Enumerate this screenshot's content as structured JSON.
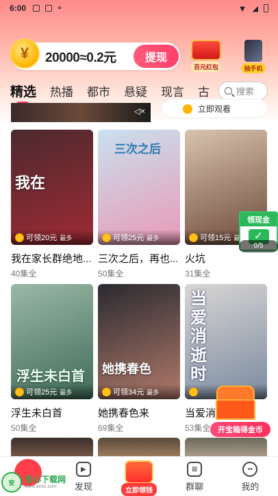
{
  "status_bar": {
    "time": "6:00"
  },
  "header": {
    "coin_text": "20000≈0.2元",
    "coin_symbol": "¥",
    "withdraw_label": "提现",
    "promo1_label": "百元红包",
    "promo2_label": "抽手机"
  },
  "tabs": [
    "精选",
    "热播",
    "都市",
    "悬疑",
    "现言",
    "古"
  ],
  "search": {
    "placeholder": "搜索"
  },
  "banner": {
    "button_label": "立即观看"
  },
  "dramas": [
    {
      "title": "我在家长群绝地...",
      "episodes": "40集全",
      "reward": "可领20元",
      "max": "最多",
      "poster_text": "我在",
      "color1": "#4a2a2e",
      "color2": "#a02a34"
    },
    {
      "title": "三次之后，再也...",
      "episodes": "50集全",
      "reward": "可领25元",
      "max": "最多",
      "poster_text": "三次之后",
      "color1": "#c9e0ee",
      "color2": "#e89ab6"
    },
    {
      "title": "火坑",
      "episodes": "31集全",
      "reward": "可领15元",
      "max": "最多",
      "poster_text": "",
      "color1": "#d8c3ae",
      "color2": "#6d4a3a"
    },
    {
      "title": "浮生未白首",
      "episodes": "50集全",
      "reward": "可领25元",
      "max": "最多",
      "poster_text": "浮生未白首",
      "color1": "#9bb8a6",
      "color2": "#3f6b58"
    },
    {
      "title": "她携春色来",
      "episodes": "69集全",
      "reward": "可领34元",
      "max": "最多",
      "poster_text": "她携春色",
      "color1": "#2a2a30",
      "color2": "#b07a6a"
    },
    {
      "title": "当爱消逝时",
      "episodes": "53集全",
      "reward": "",
      "max": "",
      "poster_text": "当爱消逝时",
      "color1": "#d9d6d4",
      "color2": "#7a8aa0"
    }
  ],
  "float_widget": {
    "label": "领现金",
    "count": "0/5"
  },
  "chest": {
    "label": "开宝箱得金币"
  },
  "bottom_nav": {
    "discover": "发现",
    "center": "立即领钱",
    "group": "群聊",
    "mine": "我的"
  },
  "watermark": {
    "text": "安心下载网",
    "sub": "www.anxz.com"
  }
}
